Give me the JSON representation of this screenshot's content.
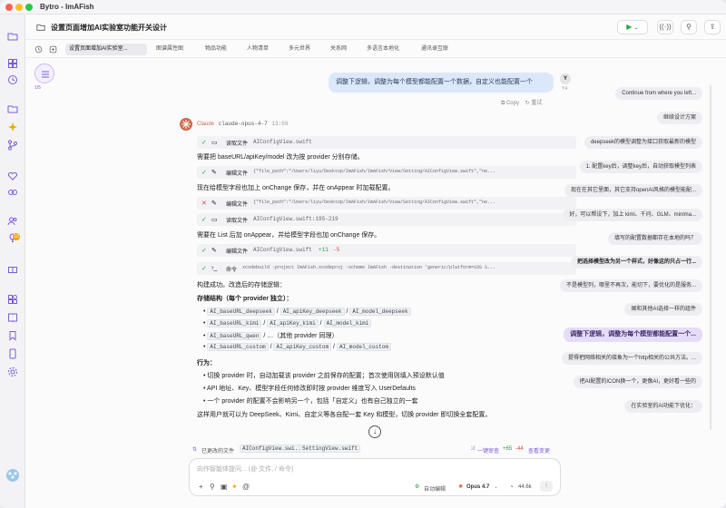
{
  "window": {
    "title": "Bytro - ImAFish"
  },
  "toolbar": {
    "page_title": "设置页面增加AI实验室功能开关设计"
  },
  "tabs": [
    "设置页面增加AI实验室...",
    "图谱属性图",
    "物品功能",
    "人物清单",
    "多元世界",
    "关系网",
    "多语言本地化",
    "通讯录互联"
  ],
  "tool_column": {
    "counter": "1/5"
  },
  "user_message": {
    "avatar": "Y",
    "avatar_sub": "Y4",
    "text": "调整下逻辑，调整为每个模型都能配置一个数据，自定义也能配置一个",
    "copy_label": "Copy",
    "retry_label": "重试"
  },
  "assistant": {
    "name": "Claude",
    "model": "claude-opus-4-7",
    "time": "13:59",
    "tool1": {
      "label": "读取文件",
      "file": "AIConfigView.swift"
    },
    "line1": "需要把 baseURL/apiKey/model 改为按 provider 分别存储。",
    "tool2": {
      "label": "编辑文件",
      "path": "{\"file_path\":\"/Users/liyu/Desktop/ImAFish/ImAFish/View/Setting/AIConfigView.swift\",\"ne..."
    },
    "line2": "现在给模型字段也加上 onChange 保存，并在 onAppear 时加载配置。",
    "tool3": {
      "label": "编辑文件",
      "path": "{\"file_path\":\"/Users/liyu/Desktop/ImAFish/ImAFish/View/Setting/AIConfigView.swift\",\"ne..."
    },
    "tool4": {
      "label": "读取文件",
      "file": "AIConfigView.swift:195-219"
    },
    "line3": "需要在 List 后加 onAppear，并给模型字段也加 onChange 保存。",
    "tool5": {
      "label": "编辑文件",
      "file": "AIConfigView.swift",
      "add": "+11",
      "del": "-5"
    },
    "tool6": {
      "label": "命令",
      "cmd": "xcodebuild -project ImAFish.xcodeproj -scheme ImAFish -destination 'generic/platform=iOS S..."
    },
    "build_ok": "构建成功。改造后的存储逻辑：",
    "storage_title": "存储结构（每个 provider 独立）：",
    "keys": [
      [
        "AI_baseURL_deepseek",
        "AI_apiKey_deepseek",
        "AI_model_deepseek"
      ],
      [
        "AI_baseURL_kimi",
        "AI_apiKey_kimi",
        "AI_model_kimi"
      ],
      [
        "AI_baseURL_qwen"
      ],
      [
        "AI_baseURL_custom",
        "AI_apiKey_custom",
        "AI_model_custom"
      ]
    ],
    "sep": "/",
    "qwen_suffix": "…（其他 provider 同理）",
    "behavior_title": "行为：",
    "behaviors": [
      "切换 provider 时，自动加载该 provider 之前保存的配置；首次使用则填入预设默认值",
      "API 地址、Key、模型字段任何修改即时按 provider 维度写入 UserDefaults",
      "一个 provider 的配置不会影响另一个，包括「自定义」也有自己独立的一套"
    ],
    "summary": "这样用户就可以为 DeepSeek、Kimi、自定义等各自配一套 Key 和模型，切换 provider 即切换全套配置。"
  },
  "right_list": [
    "Continue from where you left...",
    "继续设计方案",
    "deepseek的模型调整为接口获取最新的模型",
    "1. 配置key后，调整key后，自动获取模型列表",
    "现在在其它里面，其它支持openAI风格的模型能配...",
    "好，可以帮设下，加上 kimi、千问、GLM、minima...",
    "填写的配置数据都存在本地的吗？",
    "把选择模型改为另一个样式，好像这的只占一行...",
    "不是模型列，哪里不再次，能切下，要优化的是服务...",
    "阐和其他AI选择一样的组件",
    "调整下逻辑，调整为每个模型都能配置一个...",
    "提得把网络相关的接象为一个http相关的公共方法。...",
    "把AI配置的ICON换一个，更像AI，更好看一些的",
    "在实验室的AI功能下优化："
  ],
  "changed_files": {
    "label": "已更改的文件",
    "files": [
      "AIConfigView.swi...",
      "SettingView.swift"
    ],
    "merge_label": "一键审查",
    "add": "+65",
    "del": "-44",
    "review_label": "查看变更"
  },
  "composer": {
    "placeholder": "向作智能体提问... (@ 文件, / 命令)",
    "mode_label": "自动编辑",
    "model_label": "Opus 4.7",
    "tokens": "44.6k"
  },
  "colors": {
    "accent": "#7c5cd6",
    "green": "#2e9a4a",
    "red": "#d64545",
    "run": "#28a745",
    "blue_bubble": "#dbe8f9",
    "highlight_purple": "#e6dcf7"
  }
}
